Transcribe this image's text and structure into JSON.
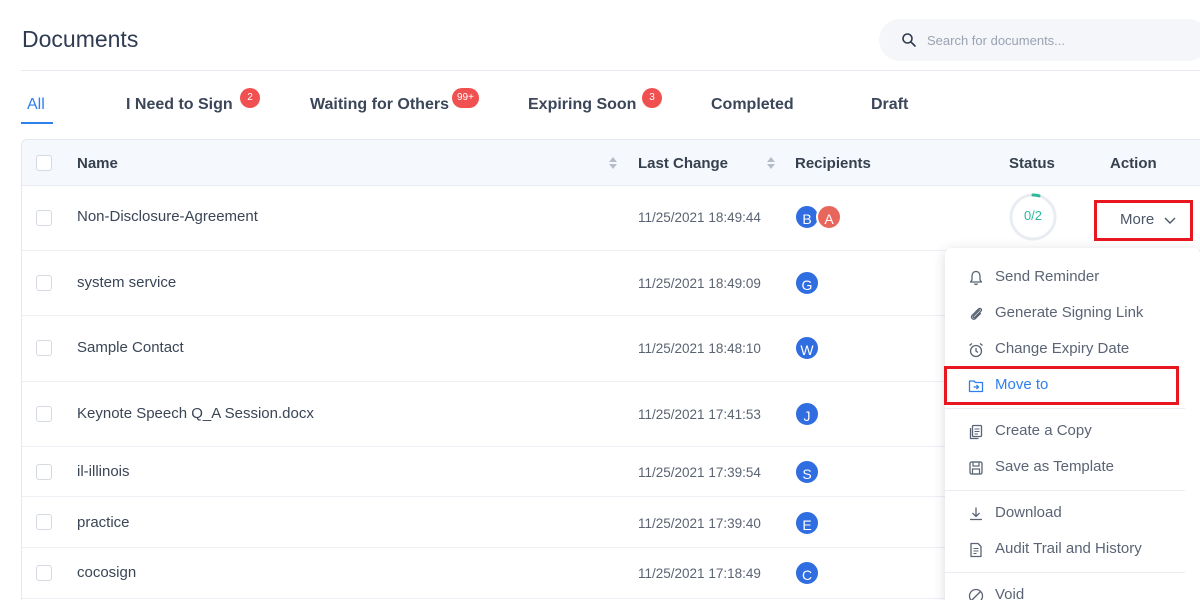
{
  "header": {
    "title": "Documents",
    "search_placeholder": "Search for documents..."
  },
  "tabs": [
    {
      "label": "All",
      "badge": ""
    },
    {
      "label": "I Need to Sign",
      "badge": "2"
    },
    {
      "label": "Waiting for Others",
      "badge": "99+"
    },
    {
      "label": "Expiring Soon",
      "badge": "3"
    },
    {
      "label": "Completed",
      "badge": ""
    },
    {
      "label": "Draft",
      "badge": ""
    }
  ],
  "table": {
    "columns": [
      "Name",
      "Last Change",
      "Recipients",
      "Status",
      "Action"
    ],
    "rows": [
      {
        "name": "Non-Disclosure-Agreement",
        "date": "11/25/2021 18:49:44",
        "recipients": [
          {
            "initial": "B",
            "color": "#2f6de0"
          },
          {
            "initial": "A",
            "color": "#e8675c"
          }
        ],
        "status": "0/2",
        "action": "More"
      },
      {
        "name": "system service",
        "date": "11/25/2021 18:49:09",
        "recipients": [
          {
            "initial": "G",
            "color": "#2f6de0"
          }
        ]
      },
      {
        "name": "Sample Contact",
        "date": "11/25/2021 18:48:10",
        "recipients": [
          {
            "initial": "W",
            "color": "#2f6de0"
          }
        ]
      },
      {
        "name": "Keynote Speech Q_A Session.docx",
        "date": "11/25/2021 17:41:53",
        "recipients": [
          {
            "initial": "J",
            "color": "#2f6de0"
          }
        ]
      },
      {
        "name": "il-illinois",
        "date": "11/25/2021 17:39:54",
        "recipients": [
          {
            "initial": "S",
            "color": "#2f6de0"
          }
        ]
      },
      {
        "name": "practice",
        "date": "11/25/2021 17:39:40",
        "recipients": [
          {
            "initial": "E",
            "color": "#2f6de0"
          }
        ]
      },
      {
        "name": "cocosign",
        "date": "11/25/2021 17:18:49",
        "recipients": [
          {
            "initial": "C",
            "color": "#2f6de0"
          }
        ]
      }
    ]
  },
  "menu": {
    "items": [
      {
        "label": "Send Reminder",
        "icon": "bell-icon"
      },
      {
        "label": "Generate Signing Link",
        "icon": "paperclip-icon"
      },
      {
        "label": "Change Expiry Date",
        "icon": "alarm-clock-icon"
      },
      {
        "label": "Move to",
        "icon": "folder-move-icon"
      },
      {
        "label": "Create a Copy",
        "icon": "copy-icon"
      },
      {
        "label": "Save as Template",
        "icon": "save-icon"
      },
      {
        "label": "Download",
        "icon": "download-icon"
      },
      {
        "label": "Audit Trail and History",
        "icon": "audit-file-icon"
      },
      {
        "label": "Void",
        "icon": "void-icon"
      }
    ]
  },
  "colors": {
    "accent": "#2f80ed",
    "badge": "#f05050",
    "highlight_box": "#e8161f",
    "status": "#2eb89a"
  }
}
